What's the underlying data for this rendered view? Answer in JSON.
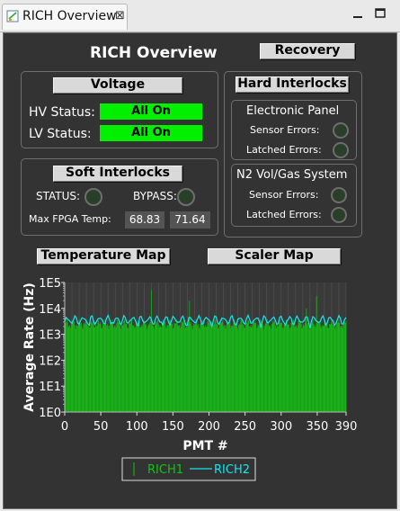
{
  "tab": {
    "title": "RICH Overview",
    "close": "⊠"
  },
  "window": {
    "minimize": "🗕",
    "maximize": "🗖"
  },
  "header": {
    "title": "RICH Overview",
    "recovery_label": "Recovery"
  },
  "voltage": {
    "button_label": "Voltage",
    "hv_label": "HV Status:",
    "hv_value": "All On",
    "lv_label": "LV Status:",
    "lv_value": "All On"
  },
  "hard_interlocks": {
    "button_label": "Hard Interlocks",
    "electronic_panel": {
      "title": "Electronic Panel",
      "sensor_label": "Sensor Errors:",
      "latched_label": "Latched Errors:"
    },
    "n2_system": {
      "title": "N2 Vol/Gas System",
      "sensor_label": "Sensor Errors:",
      "latched_label": "Latched Errors:"
    }
  },
  "soft_interlocks": {
    "button_label": "Soft Interlocks",
    "status_label": "STATUS:",
    "bypass_label": "BYPASS:",
    "fpga_label": "Max FPGA Temp:",
    "fpga_values": [
      "68.83",
      "71.64"
    ]
  },
  "maps": {
    "temperature_label": "Temperature Map",
    "scaler_label": "Scaler Map"
  },
  "colors": {
    "status_on": "#00f000",
    "rich1": "#13c313",
    "rich2": "#17e5ee",
    "panel": "#333333"
  },
  "chart_data": {
    "type": "bar",
    "xlabel": "PMT #",
    "ylabel": "Average Rate (Hz)",
    "x_ticks": [
      0,
      50,
      100,
      150,
      200,
      250,
      300,
      350,
      390
    ],
    "y_ticks": [
      "1E0",
      "1E1",
      "1E2",
      "1E3",
      "1E4",
      "1E5"
    ],
    "xlim": [
      0,
      390
    ],
    "ylim_log10": [
      0,
      5
    ],
    "y_scale": "log",
    "series": [
      {
        "name": "RICH1",
        "style": "bar",
        "typical_value": 2500,
        "spikes": [
          {
            "x": 120,
            "value": 50000
          },
          {
            "x": 173,
            "value": 20000
          },
          {
            "x": 335,
            "value": 10000
          },
          {
            "x": 349,
            "value": 30000
          }
        ]
      },
      {
        "name": "RICH2",
        "style": "line",
        "typical_value": 3500
      }
    ],
    "legend": {
      "placement": "bottom-center"
    }
  }
}
